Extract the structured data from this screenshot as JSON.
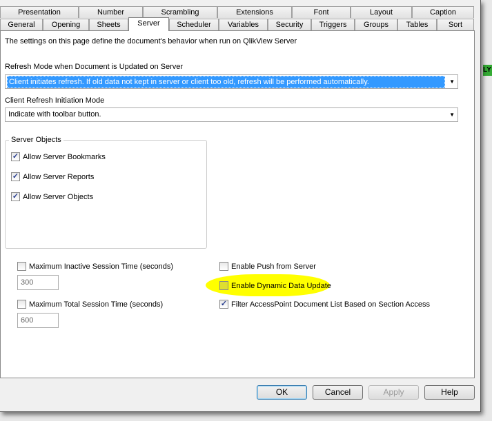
{
  "tabs_row1": [
    "Presentation",
    "Number",
    "Scrambling",
    "Extensions",
    "Font",
    "Layout",
    "Caption"
  ],
  "tabs_row2": [
    "General",
    "Opening",
    "Sheets",
    "Server",
    "Scheduler",
    "Variables",
    "Security",
    "Triggers",
    "Groups",
    "Tables",
    "Sort"
  ],
  "active_tab": "Server",
  "intro": "The settings on this page define the document's behavior when run on QlikView Server",
  "refresh_mode": {
    "label": "Refresh Mode when Document is Updated on Server",
    "value": "Client initiates refresh. If old data not kept in server or client too old, refresh will be performed automatically."
  },
  "client_refresh": {
    "label": "Client Refresh Initiation Mode",
    "value": "Indicate with toolbar button."
  },
  "server_objects": {
    "title": "Server Objects",
    "items": [
      {
        "label": "Allow Server Bookmarks",
        "checked": true
      },
      {
        "label": "Allow Server Reports",
        "checked": true
      },
      {
        "label": "Allow Server Objects",
        "checked": true
      }
    ]
  },
  "max_inactive": {
    "label": "Maximum Inactive Session Time (seconds)",
    "checked": false,
    "value": "300"
  },
  "max_total": {
    "label": "Maximum Total Session Time (seconds)",
    "checked": false,
    "value": "600"
  },
  "enable_push": {
    "label": "Enable Push from Server",
    "checked": false
  },
  "enable_dynamic": {
    "label": "Enable Dynamic Data Update",
    "checked": false
  },
  "filter_accesspoint": {
    "label": "Filter AccessPoint Document List Based on Section Access",
    "checked": true
  },
  "highlight_color": "#ffff00",
  "background_label": "LY",
  "buttons": {
    "ok": "OK",
    "cancel": "Cancel",
    "apply": "Apply",
    "help": "Help"
  }
}
